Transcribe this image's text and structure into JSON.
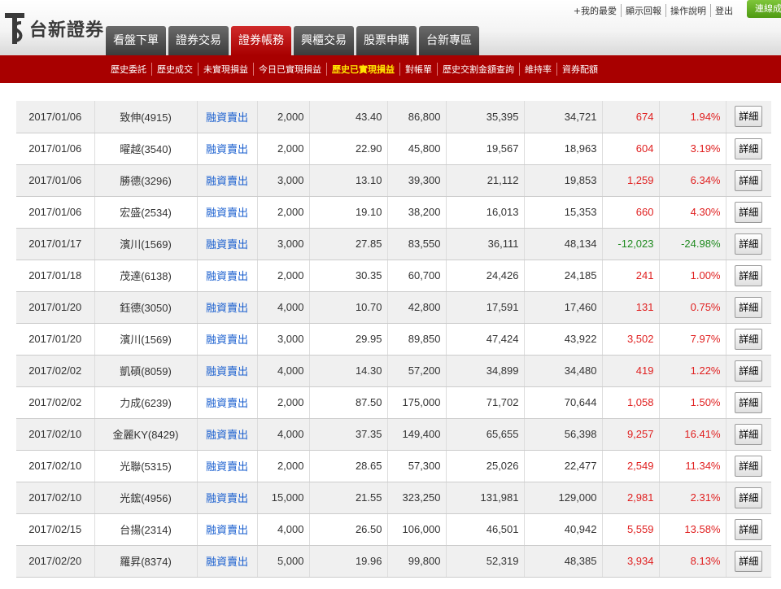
{
  "brand": {
    "logo_text": "台新證券",
    "logo_icon": "ts-logo-icon"
  },
  "main_tabs": [
    {
      "label": "看盤下單",
      "active": false
    },
    {
      "label": "證券交易",
      "active": false
    },
    {
      "label": "證券帳務",
      "active": true
    },
    {
      "label": "興櫃交易",
      "active": false
    },
    {
      "label": "股票申購",
      "active": false
    },
    {
      "label": "台新專區",
      "active": false
    }
  ],
  "util_links": [
    "+我的最愛",
    "顯示回報",
    "操作說明",
    "登出"
  ],
  "green_button": "連線成功",
  "sub_nav": [
    {
      "label": "歷史委託",
      "active": false
    },
    {
      "label": "歷史成交",
      "active": false
    },
    {
      "label": "未實現損益",
      "active": false
    },
    {
      "label": "今日已實現損益",
      "active": false
    },
    {
      "label": "歷史已實現損益",
      "active": true
    },
    {
      "label": "對帳單",
      "active": false
    },
    {
      "label": "歷史交割金額查詢",
      "active": false
    },
    {
      "label": "維持率",
      "active": false
    },
    {
      "label": "資券配額",
      "active": false
    }
  ],
  "detail_label": "詳細",
  "rows": [
    {
      "date": "2017/01/06",
      "name": "致伸(4915)",
      "type": "融資賣出",
      "qty": "2,000",
      "price": "43.40",
      "amount": "86,800",
      "cost": "35,395",
      "income": "34,721",
      "pl": "674",
      "pct": "1.94%",
      "sign": "pos"
    },
    {
      "date": "2017/01/06",
      "name": "曜越(3540)",
      "type": "融資賣出",
      "qty": "2,000",
      "price": "22.90",
      "amount": "45,800",
      "cost": "19,567",
      "income": "18,963",
      "pl": "604",
      "pct": "3.19%",
      "sign": "pos"
    },
    {
      "date": "2017/01/06",
      "name": "勝德(3296)",
      "type": "融資賣出",
      "qty": "3,000",
      "price": "13.10",
      "amount": "39,300",
      "cost": "21,112",
      "income": "19,853",
      "pl": "1,259",
      "pct": "6.34%",
      "sign": "pos"
    },
    {
      "date": "2017/01/06",
      "name": "宏盛(2534)",
      "type": "融資賣出",
      "qty": "2,000",
      "price": "19.10",
      "amount": "38,200",
      "cost": "16,013",
      "income": "15,353",
      "pl": "660",
      "pct": "4.30%",
      "sign": "pos"
    },
    {
      "date": "2017/01/17",
      "name": "濱川(1569)",
      "type": "融資賣出",
      "qty": "3,000",
      "price": "27.85",
      "amount": "83,550",
      "cost": "36,111",
      "income": "48,134",
      "pl": "-12,023",
      "pct": "-24.98%",
      "sign": "neg"
    },
    {
      "date": "2017/01/18",
      "name": "茂達(6138)",
      "type": "融資賣出",
      "qty": "2,000",
      "price": "30.35",
      "amount": "60,700",
      "cost": "24,426",
      "income": "24,185",
      "pl": "241",
      "pct": "1.00%",
      "sign": "pos"
    },
    {
      "date": "2017/01/20",
      "name": "鈺德(3050)",
      "type": "融資賣出",
      "qty": "4,000",
      "price": "10.70",
      "amount": "42,800",
      "cost": "17,591",
      "income": "17,460",
      "pl": "131",
      "pct": "0.75%",
      "sign": "pos"
    },
    {
      "date": "2017/01/20",
      "name": "濱川(1569)",
      "type": "融資賣出",
      "qty": "3,000",
      "price": "29.95",
      "amount": "89,850",
      "cost": "47,424",
      "income": "43,922",
      "pl": "3,502",
      "pct": "7.97%",
      "sign": "pos"
    },
    {
      "date": "2017/02/02",
      "name": "凱碩(8059)",
      "type": "融資賣出",
      "qty": "4,000",
      "price": "14.30",
      "amount": "57,200",
      "cost": "34,899",
      "income": "34,480",
      "pl": "419",
      "pct": "1.22%",
      "sign": "pos"
    },
    {
      "date": "2017/02/02",
      "name": "力成(6239)",
      "type": "融資賣出",
      "qty": "2,000",
      "price": "87.50",
      "amount": "175,000",
      "cost": "71,702",
      "income": "70,644",
      "pl": "1,058",
      "pct": "1.50%",
      "sign": "pos"
    },
    {
      "date": "2017/02/10",
      "name": "金麗KY(8429)",
      "type": "融資賣出",
      "qty": "4,000",
      "price": "37.35",
      "amount": "149,400",
      "cost": "65,655",
      "income": "56,398",
      "pl": "9,257",
      "pct": "16.41%",
      "sign": "pos"
    },
    {
      "date": "2017/02/10",
      "name": "光聯(5315)",
      "type": "融資賣出",
      "qty": "2,000",
      "price": "28.65",
      "amount": "57,300",
      "cost": "25,026",
      "income": "22,477",
      "pl": "2,549",
      "pct": "11.34%",
      "sign": "pos"
    },
    {
      "date": "2017/02/10",
      "name": "光鋐(4956)",
      "type": "融資賣出",
      "qty": "15,000",
      "price": "21.55",
      "amount": "323,250",
      "cost": "131,981",
      "income": "129,000",
      "pl": "2,981",
      "pct": "2.31%",
      "sign": "pos"
    },
    {
      "date": "2017/02/15",
      "name": "台揚(2314)",
      "type": "融資賣出",
      "qty": "4,000",
      "price": "26.50",
      "amount": "106,000",
      "cost": "46,501",
      "income": "40,942",
      "pl": "5,559",
      "pct": "13.58%",
      "sign": "pos"
    },
    {
      "date": "2017/02/20",
      "name": "羅昇(8374)",
      "type": "融資賣出",
      "qty": "5,000",
      "price": "19.96",
      "amount": "99,800",
      "cost": "52,319",
      "income": "48,385",
      "pl": "3,934",
      "pct": "8.13%",
      "sign": "pos"
    }
  ]
}
